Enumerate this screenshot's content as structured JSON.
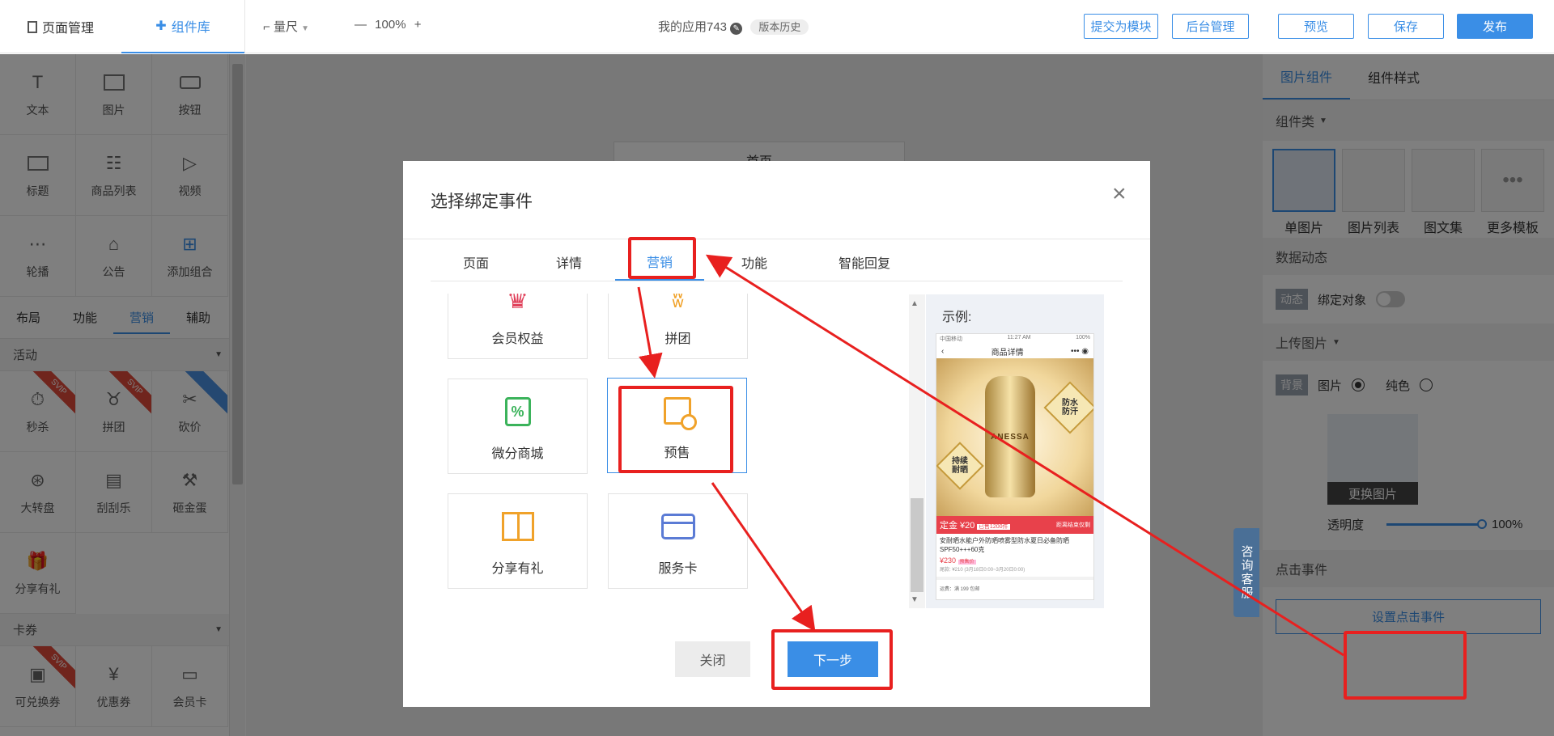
{
  "topbar": {
    "tab_page_mgmt": "页面管理",
    "tab_components": "组件库",
    "ruler": "量尺",
    "zoom": "100%",
    "app_name": "我的应用743",
    "version_history": "版本历史",
    "submit_module": "提交为模块",
    "backend": "后台管理",
    "preview": "预览",
    "save": "保存",
    "publish": "发布"
  },
  "left": {
    "basic": [
      "文本",
      "图片",
      "按钮",
      "标题",
      "商品列表",
      "视频",
      "轮播",
      "公告",
      "添加组合"
    ],
    "subtabs": [
      "布局",
      "功能",
      "营销",
      "辅助"
    ],
    "activity_header": "活动",
    "activity": [
      "秒杀",
      "拼团",
      "砍价",
      "大转盘",
      "刮刮乐",
      "砸金蛋",
      "分享有礼"
    ],
    "ribbon_svip": "SVIP",
    "coupon_header": "卡券",
    "coupons": [
      "可兑换券",
      "优惠券",
      "会员卡"
    ]
  },
  "canvas": {
    "page_title": "首页"
  },
  "modal": {
    "title": "选择绑定事件",
    "tabs": [
      "页面",
      "详情",
      "营销",
      "功能",
      "智能回复"
    ],
    "active_tab": "营销",
    "cards": [
      "会员权益",
      "拼团",
      "微分商城",
      "预售",
      "分享有礼",
      "服务卡"
    ],
    "selected": "预售",
    "example_label": "示例:",
    "close": "关闭",
    "next": "下一步",
    "phone": {
      "status_left": "中国移动",
      "status_time": "11:27 AM",
      "status_right": "100%",
      "nav_title": "商品详情",
      "badge_top": "防水",
      "badge_top2": "防汗",
      "badge_left": "持续",
      "badge_left2": "耐晒",
      "product_name": "ANESSA",
      "deposit": "定金 ¥20",
      "deposit_tag": "已售1200件",
      "end_label": "距离结束仅剩",
      "desc": "安耐晒水能户外防晒喷雾型防水夏日必备防晒SPF50+++60克",
      "price": "¥230",
      "price_tag": "预售价",
      "presale_info": "尾款: ¥210  (3月18日0:00~3月20日0:00)",
      "shipping": "运费：满 199 包邮"
    }
  },
  "right": {
    "tab1": "图片组件",
    "tab2": "组件样式",
    "component_type": "组件类",
    "templates": [
      "单图片",
      "图片列表",
      "图文集",
      "更多模板"
    ],
    "data_dynamic": "数据动态",
    "dyn_tag": "动态",
    "bind_object": "绑定对象",
    "upload_image": "上传图片",
    "bg_tag": "背景",
    "opt_image": "图片",
    "opt_solid": "纯色",
    "replace_image": "更换图片",
    "opacity_label": "透明度",
    "opacity_value": "100%",
    "click_event": "点击事件",
    "set_click_event": "设置点击事件"
  },
  "float_service": "咨询客服",
  "colors": {
    "accent": "#3a8ee6",
    "annotation": "#e8201f"
  }
}
